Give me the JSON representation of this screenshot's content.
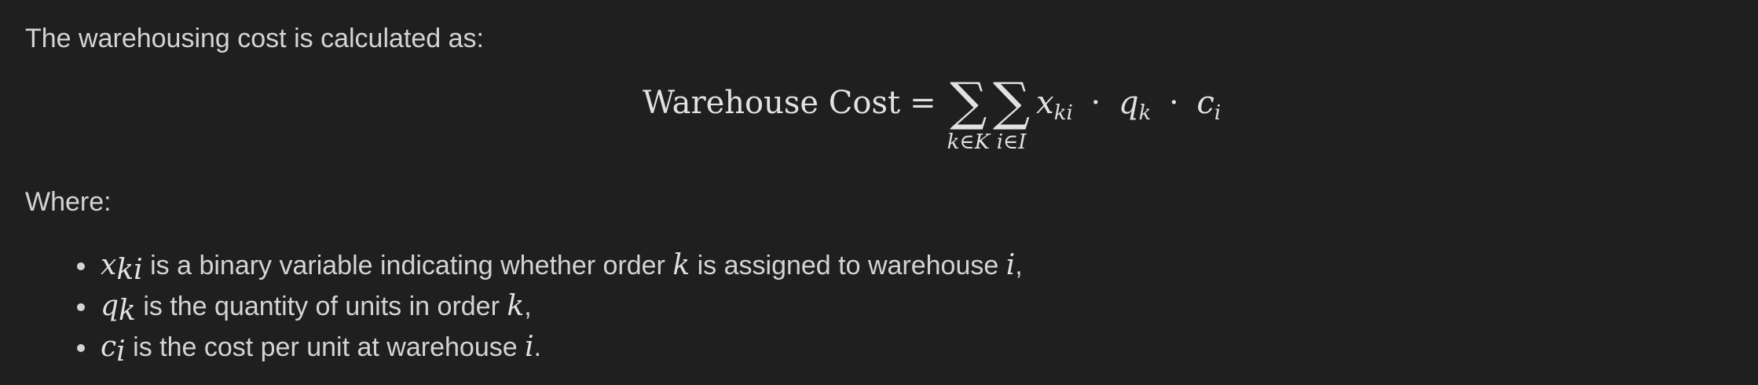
{
  "intro": "The warehousing cost is calculated as:",
  "equation": {
    "label": "Warehouse Cost",
    "equals": "=",
    "sum_symbol": "∑",
    "sum1_sub": "k∈K",
    "sum2_sub": "i∈I",
    "x": "x",
    "x_sub": "ki",
    "dot": "·",
    "q": "q",
    "q_sub": "k",
    "c": "c",
    "c_sub": "i"
  },
  "where": "Where:",
  "bullets": [
    {
      "sym": "x",
      "sym_sub": "ki",
      "text_a": " is a binary variable indicating whether order ",
      "var1": "k",
      "text_b": " is assigned to warehouse ",
      "var2": "i",
      "end": ","
    },
    {
      "sym": "q",
      "sym_sub": "k",
      "text_a": " is the quantity of units in order ",
      "var1": "k",
      "end": ","
    },
    {
      "sym": "c",
      "sym_sub": "i",
      "text_a": " is the cost per unit at warehouse ",
      "var1": "i",
      "end": "."
    }
  ]
}
